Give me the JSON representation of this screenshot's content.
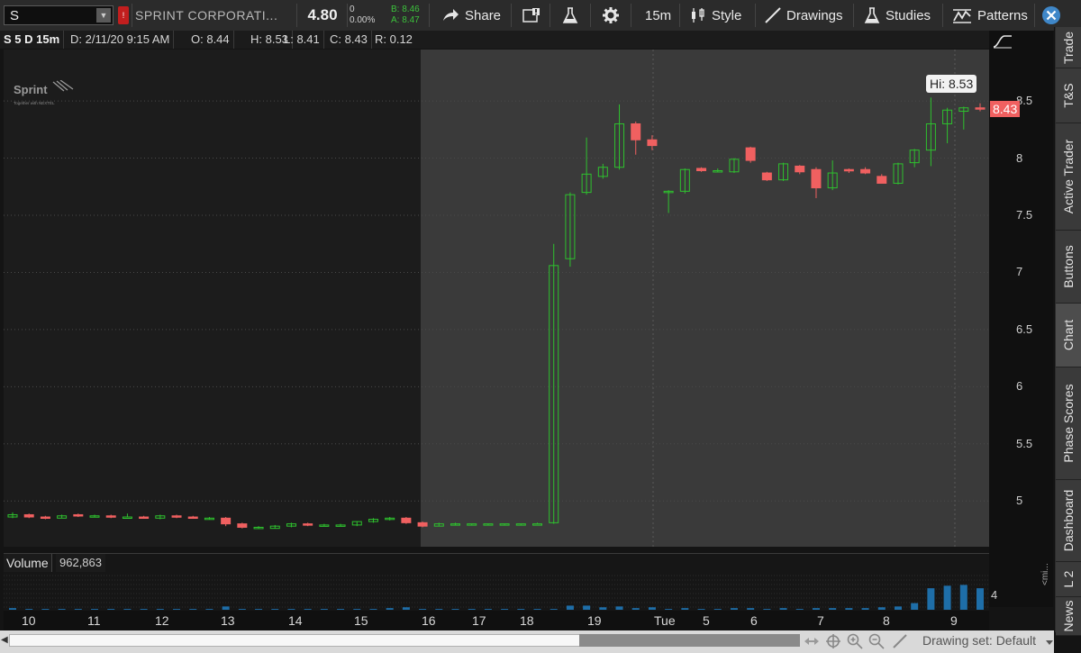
{
  "toolbar": {
    "symbol": "S",
    "company": "SPRINT CORPORATI...",
    "last": "4.80",
    "change": "0",
    "change_pct": "0.00%",
    "bid": "B: 8.46",
    "ask": "A: 8.47",
    "share_label": "Share",
    "timeframe_label": "15m",
    "style_label": "Style",
    "drawings_label": "Drawings",
    "studies_label": "Studies",
    "patterns_label": "Patterns"
  },
  "chart_header": {
    "title": "S 5 D 15m",
    "date": "D: 2/11/20 9:15 AM",
    "open": "O: 8.44",
    "high": "H: 8.53",
    "low": "L: 8.41",
    "close": "C: 8.43",
    "range": "R: 0.12"
  },
  "logo": {
    "name": "Sprint",
    "tagline": "Together with NEXTEL"
  },
  "overlays": {
    "hi_label": "Hi: 8.53",
    "last_tag": "8.43"
  },
  "volume": {
    "label": "Volume",
    "value": "962,863",
    "axis_label": "4"
  },
  "sidebar": [
    "Trade",
    "T&S",
    "Active Trader",
    "Buttons",
    "Chart",
    "Phase Scores",
    "Dashboard",
    "L 2",
    "News"
  ],
  "xaxis_labels": [
    "10",
    "11",
    "12",
    "13",
    "14",
    "15",
    "16",
    "17",
    "18",
    "19",
    "Tue",
    "5",
    "6",
    "7",
    "8",
    "9"
  ],
  "bottom": {
    "drawing_set": "Drawing set: Default"
  },
  "colors": {
    "up": "#2ec12e",
    "down": "#f06060",
    "volume": "#1e6ea8",
    "extended_bg": "#3a3a3a"
  },
  "chart_data": {
    "type": "candlestick",
    "ylim": [
      4.6,
      8.95
    ],
    "yticks": [
      5,
      5.5,
      6,
      6.5,
      7,
      7.5,
      8,
      8.5
    ],
    "candles": [
      {
        "o": 4.86,
        "h": 4.9,
        "l": 4.85,
        "c": 4.88
      },
      {
        "o": 4.88,
        "h": 4.89,
        "l": 4.85,
        "c": 4.86
      },
      {
        "o": 4.86,
        "h": 4.87,
        "l": 4.84,
        "c": 4.85
      },
      {
        "o": 4.85,
        "h": 4.88,
        "l": 4.85,
        "c": 4.87
      },
      {
        "o": 4.88,
        "h": 4.89,
        "l": 4.86,
        "c": 4.87
      },
      {
        "o": 4.87,
        "h": 4.88,
        "l": 4.86,
        "c": 4.87
      },
      {
        "o": 4.87,
        "h": 4.88,
        "l": 4.85,
        "c": 4.86
      },
      {
        "o": 4.86,
        "h": 4.89,
        "l": 4.86,
        "c": 4.86
      },
      {
        "o": 4.86,
        "h": 4.87,
        "l": 4.85,
        "c": 4.85
      },
      {
        "o": 4.85,
        "h": 4.88,
        "l": 4.84,
        "c": 4.87
      },
      {
        "o": 4.87,
        "h": 4.88,
        "l": 4.85,
        "c": 4.86
      },
      {
        "o": 4.86,
        "h": 4.87,
        "l": 4.85,
        "c": 4.85
      },
      {
        "o": 4.85,
        "h": 4.86,
        "l": 4.84,
        "c": 4.85
      },
      {
        "o": 4.85,
        "h": 4.86,
        "l": 4.78,
        "c": 4.8
      },
      {
        "o": 4.8,
        "h": 4.81,
        "l": 4.76,
        "c": 4.77
      },
      {
        "o": 4.77,
        "h": 4.78,
        "l": 4.76,
        "c": 4.77
      },
      {
        "o": 4.76,
        "h": 4.79,
        "l": 4.76,
        "c": 4.78
      },
      {
        "o": 4.78,
        "h": 4.81,
        "l": 4.77,
        "c": 4.8
      },
      {
        "o": 4.8,
        "h": 4.81,
        "l": 4.78,
        "c": 4.79
      },
      {
        "o": 4.79,
        "h": 4.8,
        "l": 4.78,
        "c": 4.79
      },
      {
        "o": 4.79,
        "h": 4.8,
        "l": 4.78,
        "c": 4.79
      },
      {
        "o": 4.79,
        "h": 4.82,
        "l": 4.78,
        "c": 4.82
      },
      {
        "o": 4.82,
        "h": 4.85,
        "l": 4.81,
        "c": 4.84
      },
      {
        "o": 4.84,
        "h": 4.86,
        "l": 4.83,
        "c": 4.85
      },
      {
        "o": 4.85,
        "h": 4.86,
        "l": 4.8,
        "c": 4.81
      },
      {
        "o": 4.81,
        "h": 4.82,
        "l": 4.77,
        "c": 4.78
      },
      {
        "o": 4.78,
        "h": 4.81,
        "l": 4.78,
        "c": 4.8
      },
      {
        "o": 4.8,
        "h": 4.81,
        "l": 4.79,
        "c": 4.8
      },
      {
        "o": 4.8,
        "h": 4.8,
        "l": 4.79,
        "c": 4.8
      },
      {
        "o": 4.8,
        "h": 4.8,
        "l": 4.79,
        "c": 4.8
      },
      {
        "o": 4.8,
        "h": 4.8,
        "l": 4.79,
        "c": 4.8
      },
      {
        "o": 4.8,
        "h": 4.8,
        "l": 4.79,
        "c": 4.8
      },
      {
        "o": 4.8,
        "h": 4.81,
        "l": 4.8,
        "c": 4.8
      },
      {
        "o": 4.81,
        "h": 7.25,
        "l": 4.8,
        "c": 7.06
      },
      {
        "o": 7.12,
        "h": 7.7,
        "l": 7.05,
        "c": 7.68
      },
      {
        "o": 7.7,
        "h": 8.18,
        "l": 7.68,
        "c": 7.86
      },
      {
        "o": 7.84,
        "h": 7.95,
        "l": 7.82,
        "c": 7.92
      },
      {
        "o": 7.92,
        "h": 8.47,
        "l": 7.9,
        "c": 8.3
      },
      {
        "o": 8.3,
        "h": 8.32,
        "l": 8.03,
        "c": 8.16
      },
      {
        "o": 8.16,
        "h": 8.2,
        "l": 8.07,
        "c": 8.11
      },
      {
        "o": 7.71,
        "h": 7.72,
        "l": 7.52,
        "c": 7.71
      },
      {
        "o": 7.71,
        "h": 7.91,
        "l": 7.69,
        "c": 7.9
      },
      {
        "o": 7.91,
        "h": 7.92,
        "l": 7.88,
        "c": 7.89
      },
      {
        "o": 7.89,
        "h": 7.91,
        "l": 7.88,
        "c": 7.89
      },
      {
        "o": 7.88,
        "h": 8.0,
        "l": 7.87,
        "c": 7.99
      },
      {
        "o": 8.09,
        "h": 8.1,
        "l": 7.96,
        "c": 7.98
      },
      {
        "o": 7.87,
        "h": 7.88,
        "l": 7.8,
        "c": 7.81
      },
      {
        "o": 7.81,
        "h": 7.96,
        "l": 7.8,
        "c": 7.95
      },
      {
        "o": 7.93,
        "h": 7.94,
        "l": 7.86,
        "c": 7.88
      },
      {
        "o": 7.9,
        "h": 7.92,
        "l": 7.65,
        "c": 7.74
      },
      {
        "o": 7.74,
        "h": 7.98,
        "l": 7.72,
        "c": 7.87
      },
      {
        "o": 7.9,
        "h": 7.91,
        "l": 7.87,
        "c": 7.89
      },
      {
        "o": 7.9,
        "h": 7.92,
        "l": 7.86,
        "c": 7.87
      },
      {
        "o": 7.84,
        "h": 7.86,
        "l": 7.78,
        "c": 7.78
      },
      {
        "o": 7.78,
        "h": 7.96,
        "l": 7.77,
        "c": 7.95
      },
      {
        "o": 7.96,
        "h": 8.08,
        "l": 7.92,
        "c": 8.07
      },
      {
        "o": 8.07,
        "h": 8.53,
        "l": 7.93,
        "c": 8.3
      },
      {
        "o": 8.3,
        "h": 8.44,
        "l": 8.13,
        "c": 8.42
      },
      {
        "o": 8.41,
        "h": 8.45,
        "l": 8.25,
        "c": 8.44
      },
      {
        "o": 8.44,
        "h": 8.48,
        "l": 8.41,
        "c": 8.43
      }
    ],
    "volume_scale_max": 5,
    "volume": [
      0.2,
      0.1,
      0.1,
      0.1,
      0.1,
      0.1,
      0.1,
      0.1,
      0.1,
      0.1,
      0.1,
      0.1,
      0.1,
      0.4,
      0.1,
      0.1,
      0.1,
      0.1,
      0.1,
      0.1,
      0.1,
      0.1,
      0.1,
      0.2,
      0.3,
      0.1,
      0.1,
      0.1,
      0.1,
      0.1,
      0.1,
      0.1,
      0.1,
      0.1,
      0.5,
      0.5,
      0.3,
      0.4,
      0.2,
      0.3,
      0.1,
      0.2,
      0.1,
      0.1,
      0.2,
      0.2,
      0.1,
      0.2,
      0.1,
      0.2,
      0.2,
      0.2,
      0.2,
      0.3,
      0.4,
      0.8,
      2.6,
      2.9,
      3.0,
      2.6
    ]
  }
}
